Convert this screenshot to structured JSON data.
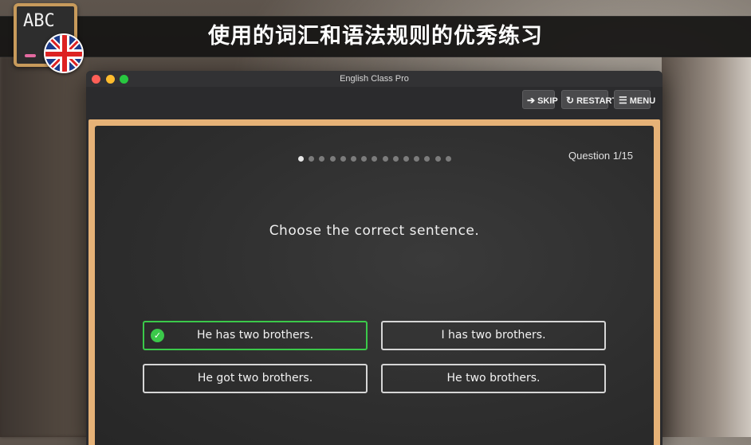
{
  "banner": {
    "title": "使用的词汇和语法规则的优秀练习"
  },
  "app_icon": {
    "text": "ABC",
    "flag": "uk-flag-icon"
  },
  "window": {
    "title": "English Class Pro"
  },
  "toolbar": {
    "skip_label": "SKIP",
    "restart_label": "RESTART",
    "menu_label": "MENU"
  },
  "quiz": {
    "counter": "Question 1/15",
    "total_questions": 15,
    "current_index": 1,
    "prompt": "Choose the correct sentence.",
    "answers": [
      {
        "text": "He has two brothers.",
        "state": "correct"
      },
      {
        "text": "I has two brothers.",
        "state": "default"
      },
      {
        "text": "He got two brothers.",
        "state": "default"
      },
      {
        "text": "He two brothers.",
        "state": "default"
      }
    ]
  },
  "colors": {
    "correct": "#3bc94a",
    "board": "#2e2e2e",
    "frame": "#e6b277"
  }
}
